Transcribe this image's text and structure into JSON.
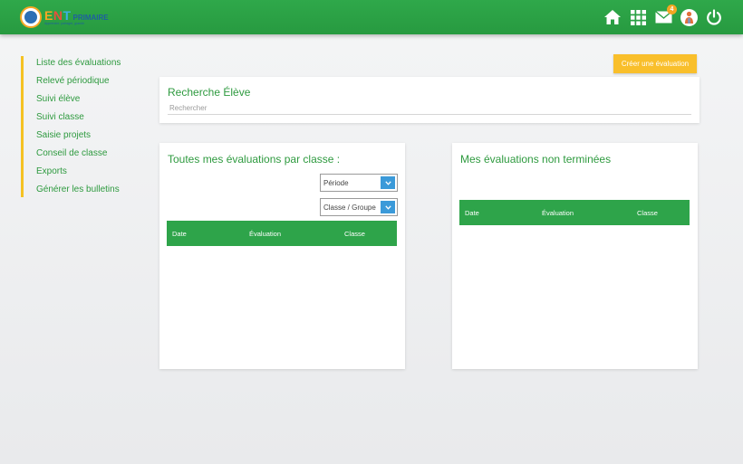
{
  "header": {
    "logo": {
      "ent_e": "E",
      "ent_n": "N",
      "ent_t": "T",
      "primaire": "PRIMAIRE",
      "tagline": "Apprendre, partager, grandir"
    },
    "notification_count": "4",
    "icons": [
      "home-icon",
      "apps-grid-icon",
      "mail-icon",
      "user-avatar-icon",
      "power-icon"
    ]
  },
  "sidebar": {
    "items": [
      {
        "label": "Liste des évaluations"
      },
      {
        "label": "Relevé périodique"
      },
      {
        "label": "Suivi élève"
      },
      {
        "label": "Suivi classe"
      },
      {
        "label": "Saisie projets"
      },
      {
        "label": "Conseil de classe"
      },
      {
        "label": "Exports"
      },
      {
        "label": "Générer les bulletins"
      }
    ]
  },
  "create_button": {
    "label": "Créer une évaluation"
  },
  "search": {
    "title": "Recherche Élève",
    "placeholder": "Rechercher"
  },
  "evaluations": {
    "title": "Toutes mes évaluations par classe :",
    "periode_select": "Période",
    "classe_select": "Classe / Groupe",
    "columns": [
      "Date",
      "Évaluation",
      "Classe"
    ]
  },
  "pending": {
    "title": "Mes évaluations non terminées",
    "columns": [
      "Date",
      "Évaluation",
      "Classe"
    ]
  },
  "colors": {
    "header_green": "#2fa84a",
    "accent_yellow": "#f9bf2b",
    "text_green": "#2e9a3f",
    "select_blue": "#3b9ad9"
  }
}
